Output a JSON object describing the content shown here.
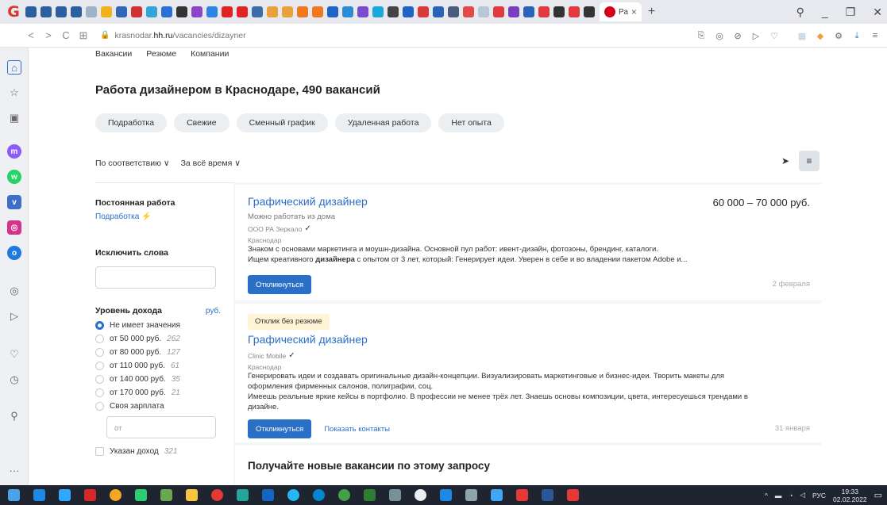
{
  "browser": {
    "tab_title": "Ра",
    "tab_close": "×",
    "new_tab": "+",
    "controls": {
      "search": "⚲",
      "minimize": "_",
      "restore": "❐",
      "close": "✕"
    },
    "url_host_prefix": "krasnodar.",
    "url_host_bold": "hh.ru",
    "url_path": "/vacancies/dizayner",
    "accent": "#2b70c7"
  },
  "page": {
    "subnav": [
      "Вакансии",
      "Резюме",
      "Компании"
    ],
    "title": "Работа дизайнером в Краснодаре, 490 вакансий",
    "chips": [
      "Подработка",
      "Свежие",
      "Сменный график",
      "Удаленная работа",
      "Нет опыта"
    ],
    "sort": {
      "relevance": "По соответствию ∨",
      "period": "За всё время ∨"
    }
  },
  "filters": {
    "employment_title": "Постоянная работа",
    "employment_link": "Подработка",
    "exclude_title": "Исключить слова",
    "income_title": "Уровень дохода",
    "income_currency": "руб.",
    "income_options": [
      {
        "label": "Не имеет значения",
        "count": ""
      },
      {
        "label": "от 50 000 руб.",
        "count": "262"
      },
      {
        "label": "от 80 000 руб.",
        "count": "127"
      },
      {
        "label": "от 110 000 руб.",
        "count": "61"
      },
      {
        "label": "от 140 000 руб.",
        "count": "35"
      },
      {
        "label": "от 170 000 руб.",
        "count": "21"
      },
      {
        "label": "Своя зарплата",
        "count": ""
      }
    ],
    "own_salary_placeholder": "от",
    "salary_shown_label": "Указан доход",
    "salary_shown_count": "321"
  },
  "vacancies": [
    {
      "title": "Графический дизайнер",
      "salary": "60 000 – 70 000 руб.",
      "remote": "Можно работать из дома",
      "company": "ООО РА Зеркало",
      "city": "Краснодар",
      "desc1": "Знаком с основами маркетинга и моушн-дизайна. Основной пул работ: ивент-дизайн, фотозоны, брендинг, каталоги.",
      "desc2_before": "Ищем креативного ",
      "desc2_bold": "дизайнера",
      "desc2_after": " с опытом от 3 лет, который: Генерирует идеи. Уверен в себе и во владении пакетом Adobe и...",
      "apply": "Откликнуться",
      "date": "2 февраля"
    },
    {
      "badge": "Отклик без резюме",
      "title": "Графический дизайнер",
      "company": "Clinic Mobile",
      "city": "Краснодар",
      "desc1": "Генерировать идеи и создавать оригинальные дизайн-концепции. Визуализировать маркетинговые и бизнес-идеи. Творить макеты для",
      "desc2": "оформления фирменных салонов, полиграфии, соц.",
      "desc3": "Имеешь реальные яркие кейсы в портфолио. В профессии не менее трёх лет. Знаешь основы композиции, цвета, интересуешься трендами в",
      "desc4": "дизайне.",
      "apply": "Откликнуться",
      "contacts": "Показать контакты",
      "date": "31 января"
    }
  ],
  "subscribe_title": "Получайте новые вакансии по этому запросу",
  "taskbar": {
    "lang": "РУС",
    "time": "19:33",
    "date": "02.02.2022"
  }
}
